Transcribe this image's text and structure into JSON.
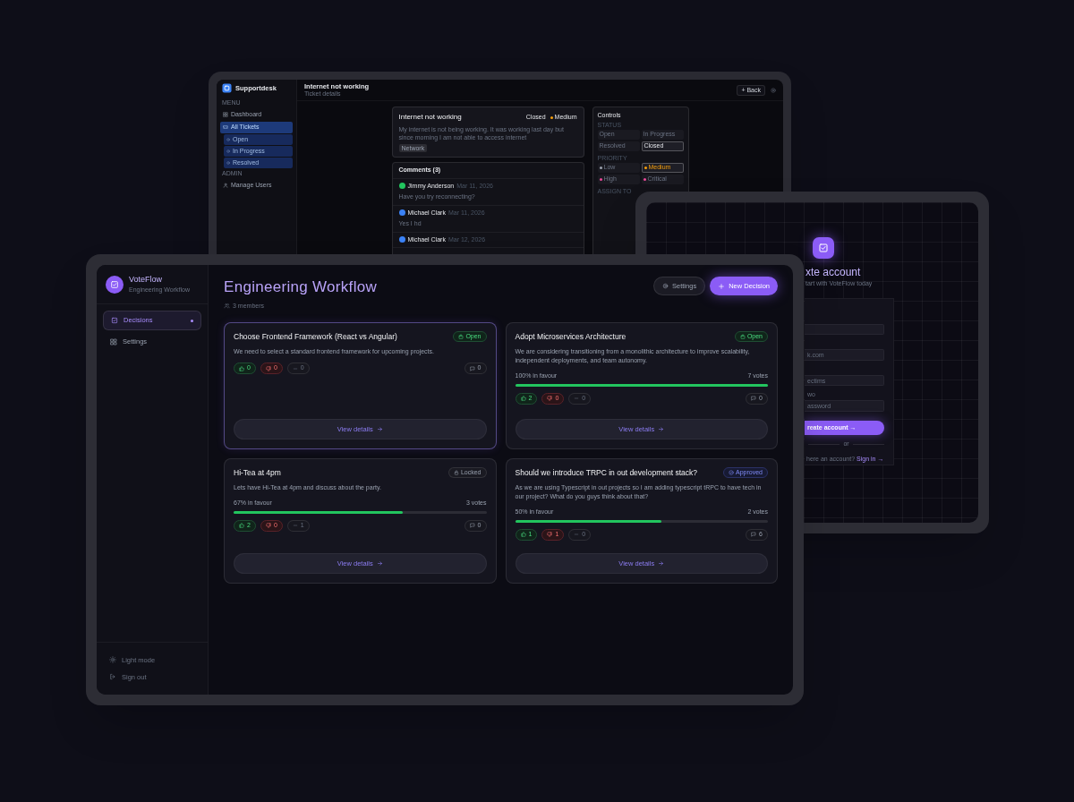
{
  "back_window": {
    "app_name": "Supportdesk",
    "sidebar": [
      {
        "heading": "MENU",
        "items": [
          {
            "label": "Dashboard",
            "selected": false
          },
          {
            "label": "All Tickets",
            "selected": true,
            "children": [
              {
                "label": "Open",
                "selected": false
              },
              {
                "label": "In Progress",
                "selected": false
              },
              {
                "label": "Resolved",
                "selected": false
              }
            ]
          }
        ]
      },
      {
        "heading": "ADMIN",
        "items": [
          {
            "label": "Manage Users",
            "selected": false
          }
        ]
      }
    ],
    "header": {
      "title": "Internet not working",
      "subtitle": "Ticket details"
    },
    "back_button": "+ Back",
    "ticket": {
      "title": "Internet not working",
      "status": "Closed",
      "priority": {
        "label": "Medium",
        "color": "#f59e0b"
      },
      "description": "My internet is not being working. It was working last day but since morning I am not able to access internet",
      "tag": "Network"
    },
    "comments": {
      "title": "Comments (3)",
      "items": [
        {
          "author": "Jimmy Anderson",
          "date": "Mar 11, 2026",
          "text": "Have you try reconnecting?",
          "color": "#22c55e"
        },
        {
          "author": "Michael Clark",
          "date": "Mar 11, 2026",
          "text": "Yes I hd",
          "color": "#3b82f6"
        },
        {
          "author": "Michael Clark",
          "date": "Mar 12, 2026",
          "color": "#3b82f6"
        }
      ]
    },
    "controls": {
      "title": "Controls",
      "groups": [
        {
          "heading": "STATUS",
          "options": [
            {
              "label": "Open",
              "selected": false
            },
            {
              "label": "In Progress",
              "selected": false
            },
            {
              "label": "Resolved",
              "selected": false
            },
            {
              "label": "Closed",
              "selected": true
            }
          ]
        },
        {
          "heading": "PRIORITY",
          "options": [
            {
              "label": "Low",
              "selected": false,
              "color": "#9ca3af"
            },
            {
              "label": "Medium",
              "selected": true,
              "color": "#f59e0b"
            },
            {
              "label": "High",
              "selected": false,
              "color": "#ec4899"
            },
            {
              "label": "Critical",
              "selected": false,
              "color": "#ec4899"
            }
          ]
        }
      ],
      "assign_heading": "ASSIGN TO"
    }
  },
  "signup_window": {
    "title": "xte account",
    "subtitle": "tart with VoteFlow today",
    "fields": [
      {
        "kind": "text"
      },
      {
        "kind": "text",
        "placeholder": "k.com"
      },
      {
        "kind": "text",
        "placeholder": "ectims"
      },
      {
        "kind": "text",
        "label": "wo",
        "placeholder": "assword"
      }
    ],
    "submit": "reate account →",
    "divider": "or",
    "footer": {
      "text": "here an account?",
      "link": "Sign in →"
    }
  },
  "main_window": {
    "app_name": "VoteFlow",
    "workspace": "Engineering Workflow",
    "nav": [
      {
        "label": "Decisions",
        "selected": true
      },
      {
        "label": "Settings",
        "selected": false
      }
    ],
    "bottom_nav": [
      "Light mode",
      "Sign out"
    ],
    "title": "Engineering Workflow",
    "members": "3 members",
    "buttons": [
      {
        "label": "Settings",
        "kind": "secondary"
      },
      {
        "label": "New Decision",
        "kind": "primary"
      }
    ],
    "cards": [
      {
        "title": "Choose Frontend Framework (React vs Angular)",
        "status": {
          "label": "Open",
          "kind": "open"
        },
        "description": "We need to select a standard frontend framework for upcoming projects.",
        "up": "0",
        "down": "0",
        "neutral": "0",
        "comments": "0",
        "action": "View details",
        "selected": true
      },
      {
        "title": "Adopt Microservices Architecture",
        "status": {
          "label": "Open",
          "kind": "open"
        },
        "description": "We are considering transitioning from a monolithic architecture to improve scalability, independent deployments, and team autonomy.",
        "progress": {
          "favour": "100% in favour",
          "votes": "7 votes",
          "level": 1.0
        },
        "up": "2",
        "down": "0",
        "neutral": "0",
        "comments": "0",
        "action": "View details",
        "selected": false
      },
      {
        "title": "Hi-Tea at 4pm",
        "status": {
          "label": "Locked",
          "kind": "locked"
        },
        "description": "Lets have Hi-Tea at 4pm and discuss about the party.",
        "progress": {
          "favour": "67% in favour",
          "votes": "3 votes",
          "level": 0.67
        },
        "up": "2",
        "down": "0",
        "neutral": "1",
        "comments": "0",
        "action": "View details",
        "selected": false
      },
      {
        "title": "Should we introduce TRPC in out development stack?",
        "status": {
          "label": "Approved",
          "kind": "approved"
        },
        "description": "As we are using Typescript in out projects so I am adding typescript tRPC to have tech in our project? What do you guys think about that?",
        "progress": {
          "favour": "50% in favour",
          "votes": "2 votes",
          "level": 0.58
        },
        "up": "1",
        "down": "1",
        "neutral": "0",
        "comments": "6",
        "action": "View details",
        "selected": false
      }
    ]
  }
}
